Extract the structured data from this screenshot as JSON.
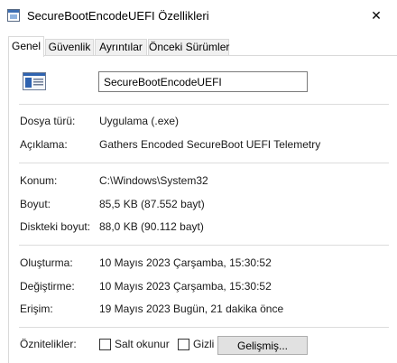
{
  "window": {
    "title": "SecureBootEncodeUEFI Özellikleri",
    "close_glyph": "✕"
  },
  "tabs": [
    {
      "label": "Genel",
      "active": true
    },
    {
      "label": "Güvenlik",
      "active": false
    },
    {
      "label": "Ayrıntılar",
      "active": false
    },
    {
      "label": "Önceki Sürümler",
      "active": false
    }
  ],
  "general": {
    "file_name": "SecureBootEncodeUEFI",
    "file_type": {
      "label": "Dosya türü:",
      "value": "Uygulama (.exe)"
    },
    "description": {
      "label": "Açıklama:",
      "value": "Gathers Encoded SecureBoot UEFI Telemetry"
    },
    "location": {
      "label": "Konum:",
      "value": "C:\\Windows\\System32"
    },
    "size": {
      "label": "Boyut:",
      "value": "85,5 KB (87.552 bayt)"
    },
    "size_on_disk": {
      "label": "Diskteki boyut:",
      "value": "88,0 KB (90.112 bayt)"
    },
    "created": {
      "label": "Oluşturma:",
      "value": "10 Mayıs 2023 Çarşamba, 15:30:52"
    },
    "modified": {
      "label": "Değiştirme:",
      "value": "10 Mayıs 2023 Çarşamba, 15:30:52"
    },
    "accessed": {
      "label": "Erişim:",
      "value": "19 Mayıs 2023 Bugün, 21 dakika önce"
    },
    "attributes": {
      "label": "Öznitelikler:",
      "readonly_label": "Salt okunur",
      "readonly_checked": false,
      "hidden_label": "Gizli",
      "hidden_checked": false,
      "advanced_button": "Gelişmiş..."
    }
  },
  "colors": {
    "accent": "#0078d7",
    "border": "#d9d9d9",
    "button_bg": "#e1e1e1"
  },
  "icons": {
    "app": "application-window-icon",
    "file": "executable-file-icon",
    "close": "close-icon"
  }
}
